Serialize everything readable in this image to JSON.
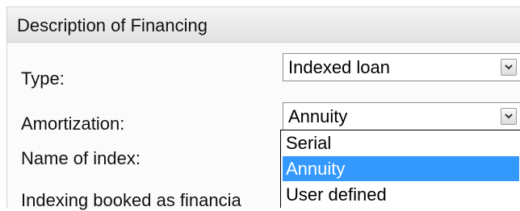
{
  "section": {
    "title": "Description of Financing"
  },
  "fields": {
    "type_label": "Type:",
    "type_value": "Indexed loan",
    "amortization_label": "Amortization:",
    "amortization_value": "Annuity",
    "index_name_label": "Name of index:",
    "indexing_label": "Indexing booked as financia"
  },
  "amortization_dropdown": {
    "options": [
      "Serial",
      "Annuity",
      "User defined"
    ],
    "selected": "Annuity"
  },
  "colors": {
    "selection": "#3399ff"
  },
  "icons": {
    "select_arrow": "chevron-down-icon"
  }
}
